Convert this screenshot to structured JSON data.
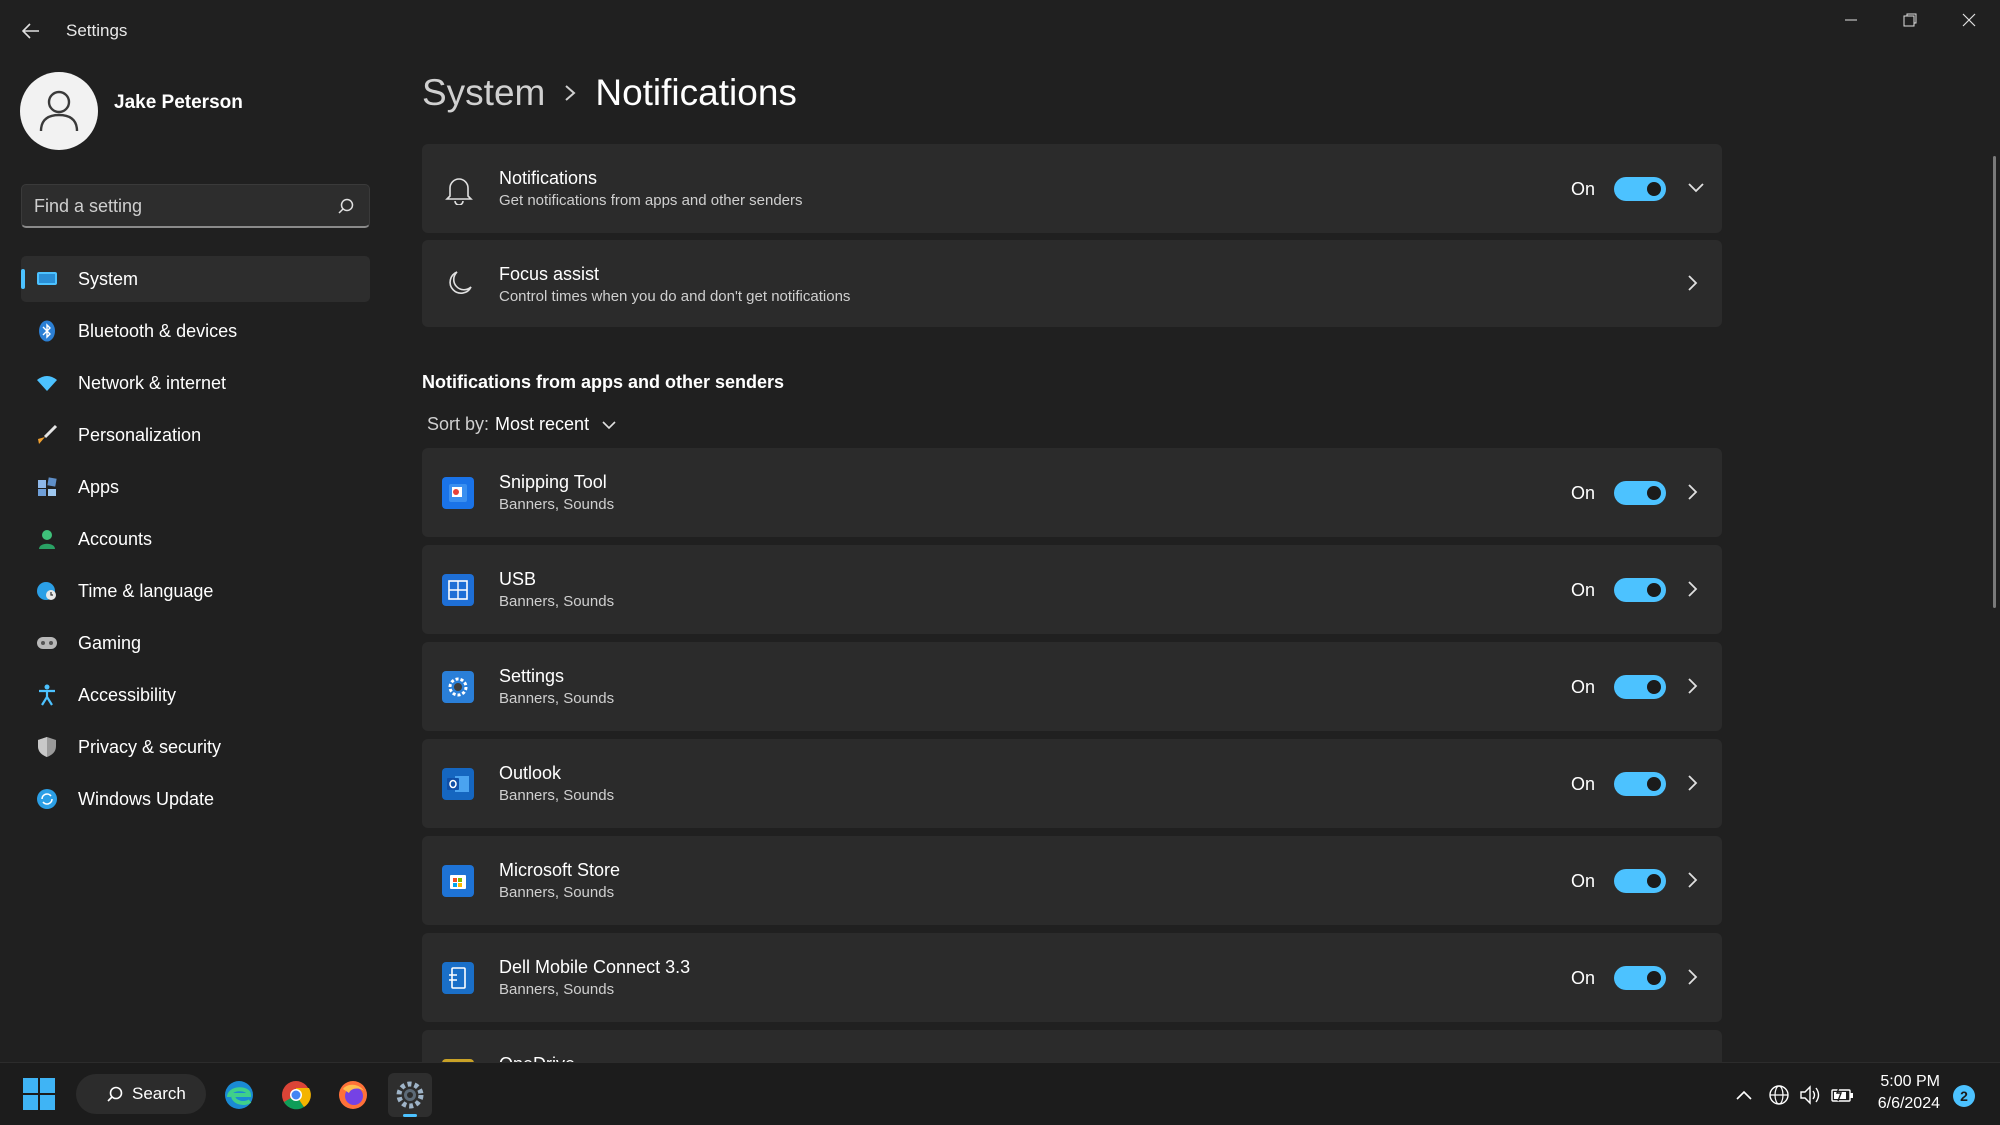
{
  "window": {
    "title": "Settings"
  },
  "profile": {
    "name": "Jake Peterson"
  },
  "search": {
    "placeholder": "Find a setting"
  },
  "sidebar": {
    "items": [
      {
        "label": "System",
        "icon": "system-icon",
        "active": true
      },
      {
        "label": "Bluetooth & devices",
        "icon": "bluetooth-icon"
      },
      {
        "label": "Network & internet",
        "icon": "wifi-icon"
      },
      {
        "label": "Personalization",
        "icon": "brush-icon"
      },
      {
        "label": "Apps",
        "icon": "apps-icon"
      },
      {
        "label": "Accounts",
        "icon": "person-icon"
      },
      {
        "label": "Time & language",
        "icon": "globe-clock-icon"
      },
      {
        "label": "Gaming",
        "icon": "controller-icon"
      },
      {
        "label": "Accessibility",
        "icon": "accessibility-icon"
      },
      {
        "label": "Privacy & security",
        "icon": "shield-icon"
      },
      {
        "label": "Windows Update",
        "icon": "update-icon"
      }
    ]
  },
  "breadcrumb": {
    "parent": "System",
    "current": "Notifications"
  },
  "notifications_card": {
    "title": "Notifications",
    "subtitle": "Get notifications from apps and other senders",
    "state": "On"
  },
  "focus_card": {
    "title": "Focus assist",
    "subtitle": "Control times when you do and don't get notifications"
  },
  "apps_section": {
    "title": "Notifications from apps and other senders",
    "sort_label": "Sort by:",
    "sort_value": "Most recent",
    "apps": [
      {
        "name": "Snipping Tool",
        "detail": "Banners, Sounds",
        "state": "On",
        "icon": "snipping-tool-icon"
      },
      {
        "name": "USB",
        "detail": "Banners, Sounds",
        "state": "On",
        "icon": "usb-icon"
      },
      {
        "name": "Settings",
        "detail": "Banners, Sounds",
        "state": "On",
        "icon": "settings-gear-icon"
      },
      {
        "name": "Outlook",
        "detail": "Banners, Sounds",
        "state": "On",
        "icon": "outlook-icon"
      },
      {
        "name": "Microsoft Store",
        "detail": "Banners, Sounds",
        "state": "On",
        "icon": "store-icon"
      },
      {
        "name": "Dell Mobile Connect 3.3",
        "detail": "Banners, Sounds",
        "state": "On",
        "icon": "dell-mobile-icon"
      },
      {
        "name": "OneDrive",
        "detail": "",
        "state": "",
        "icon": "onedrive-icon"
      }
    ]
  },
  "taskbar": {
    "search_label": "Search",
    "time": "5:00 PM",
    "date": "6/6/2024",
    "notification_count": "2"
  },
  "colors": {
    "accent": "#4cc2ff",
    "background": "#202020",
    "card": "#2b2b2b"
  }
}
